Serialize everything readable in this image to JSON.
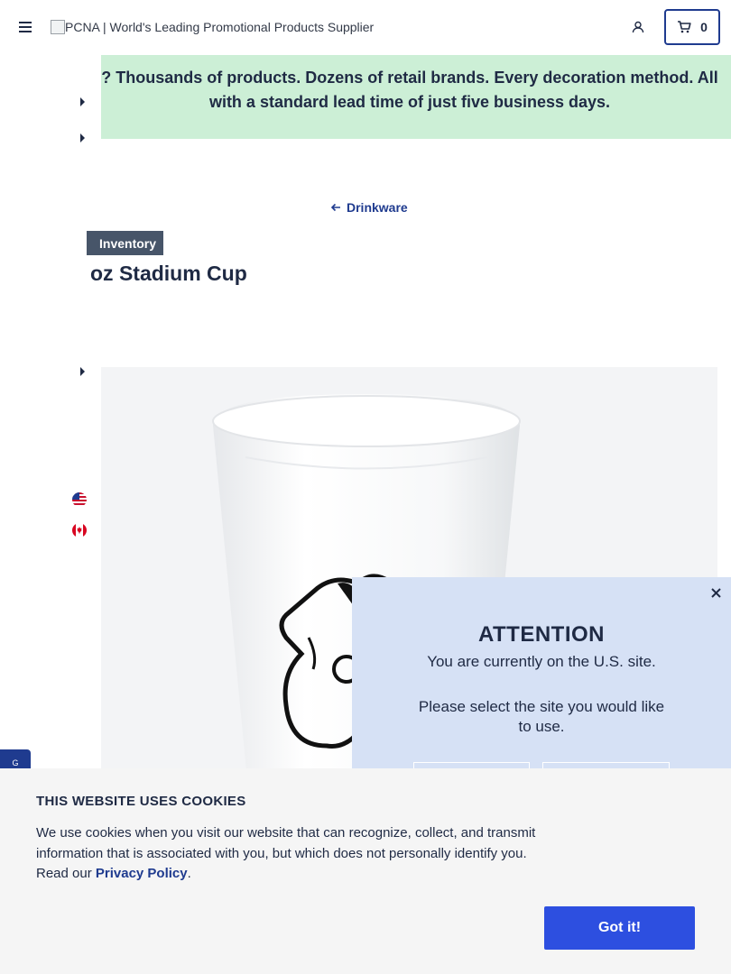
{
  "header": {
    "logo_alt": "PCNA | World's Leading Promotional Products Supplier",
    "cart_count": "0"
  },
  "banner": {
    "text": "? Thousands of products. Dozens of retail brands. Every decoration method. All with a standard lead time of just five business days."
  },
  "breadcrumb": {
    "back_label": "Drinkware"
  },
  "product": {
    "badge": "Inventory",
    "title": "oz Stadium Cup"
  },
  "chat_tab": {
    "label": "G"
  },
  "attention_modal": {
    "title": "ATTENTION",
    "line1": "You are currently on the U.S. site.",
    "line2": "Please select the site you would like to use."
  },
  "cookie_banner": {
    "title": "THIS WEBSITE USES COOKIES",
    "body": "We use cookies when you visit our website that can recognize, collect, and transmit information that is associated with you, but which does not personally identify you. Read our ",
    "link": "Privacy Policy",
    "end": ".",
    "button": "Got it!"
  },
  "colors": {
    "primary": "#1f3b8f",
    "banner_bg": "#ccefd6",
    "modal_bg": "#d6e1f5",
    "button_blue": "#2d4fe0"
  }
}
